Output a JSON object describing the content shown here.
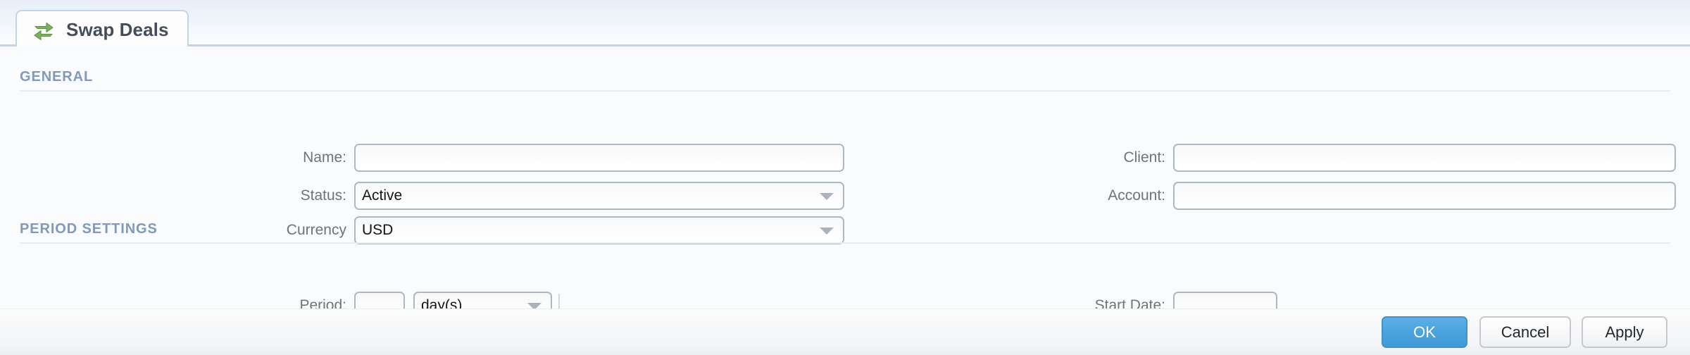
{
  "tab": {
    "icon": "swap-arrows-icon",
    "label": "Swap Deals"
  },
  "sections": {
    "general": {
      "title": "GENERAL",
      "fields": {
        "name": {
          "label": "Name:",
          "value": "",
          "placeholder": ""
        },
        "status": {
          "label": "Status:",
          "value": "Active"
        },
        "currency": {
          "label": "Currency",
          "value": "USD"
        },
        "client": {
          "label": "Client:",
          "value": "",
          "placeholder": ""
        },
        "account": {
          "label": "Account:",
          "value": "",
          "placeholder": ""
        }
      }
    },
    "period_settings": {
      "title": "PERIOD SETTINGS",
      "fields": {
        "period": {
          "label": "Period:",
          "value": "",
          "placeholder": ""
        },
        "period_unit": {
          "label": "",
          "value": "day(s)"
        },
        "start_date": {
          "label": "Start Date:",
          "value": "",
          "placeholder": ""
        }
      }
    }
  },
  "footer": {
    "ok_label": "OK",
    "cancel_label": "Cancel",
    "apply_label": "Apply"
  },
  "colors": {
    "accent": "#4aa3dd",
    "section_header": "#8099bd",
    "tab_border": "#c3d4ea",
    "icon_green": "#6aa84f"
  }
}
